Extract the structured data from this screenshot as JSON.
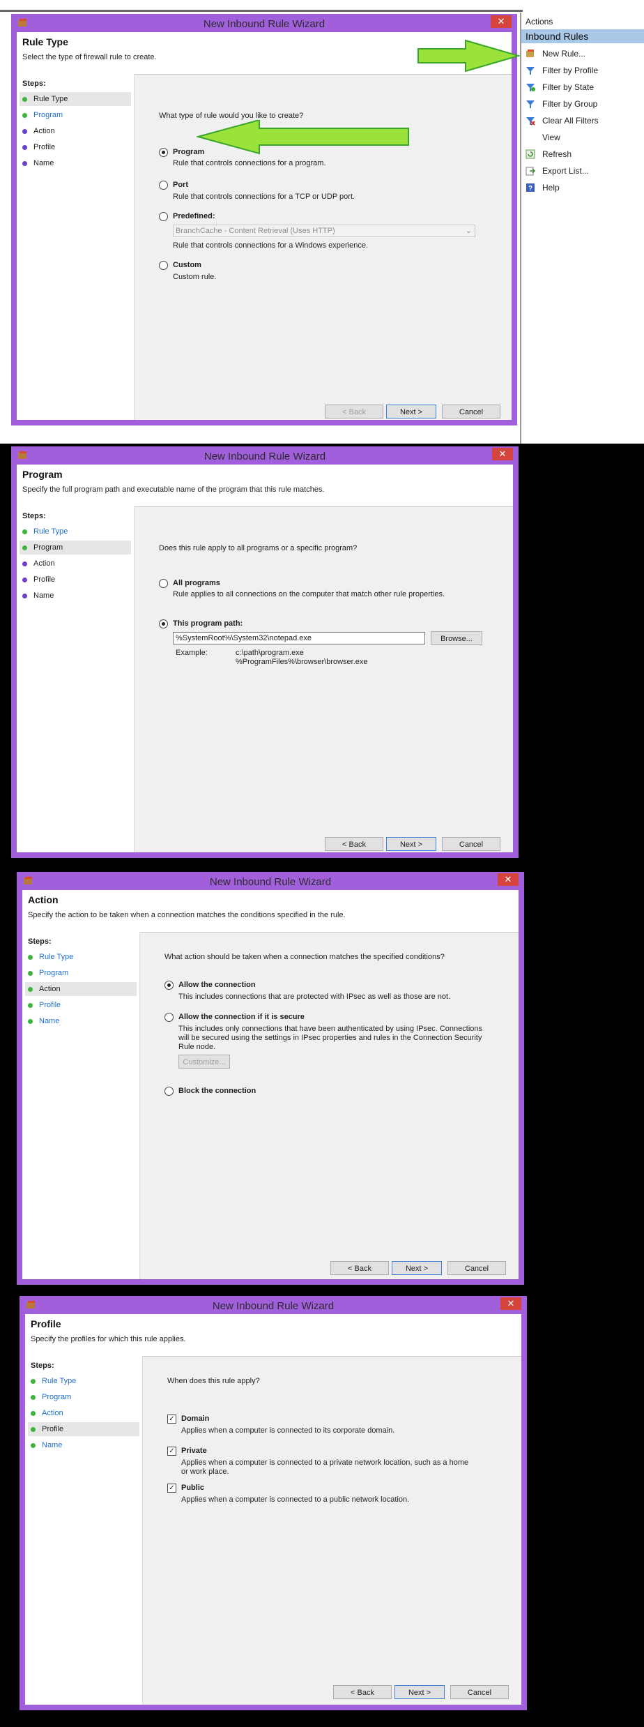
{
  "actions": {
    "header": "Actions",
    "section": "Inbound Rules",
    "items": [
      {
        "label": "New Rule...",
        "icon": "new-rule-icon"
      },
      {
        "label": "Filter by Profile",
        "icon": "filter-icon"
      },
      {
        "label": "Filter by State",
        "icon": "filter-icon"
      },
      {
        "label": "Filter by Group",
        "icon": "filter-icon"
      },
      {
        "label": "Clear All Filters",
        "icon": "clear-filter-icon"
      },
      {
        "label": "View",
        "icon": ""
      },
      {
        "label": "Refresh",
        "icon": "refresh-icon"
      },
      {
        "label": "Export List...",
        "icon": "export-icon"
      },
      {
        "label": "Help",
        "icon": "help-icon"
      }
    ]
  },
  "wizard": {
    "title": "New Inbound Rule Wizard",
    "close": "✕",
    "steps_label": "Steps:",
    "steps": [
      "Rule Type",
      "Program",
      "Action",
      "Profile",
      "Name"
    ],
    "buttons": {
      "back": "< Back",
      "next": "Next >",
      "cancel": "Cancel"
    }
  },
  "panel1": {
    "heading": "Rule Type",
    "subheading": "Select the type of firewall rule to create.",
    "question": "What type of rule would you like to create?",
    "options": [
      {
        "label": "Program",
        "desc": "Rule that controls connections for a program.",
        "selected": true
      },
      {
        "label": "Port",
        "desc": "Rule that controls connections for a TCP or UDP port.",
        "selected": false
      },
      {
        "label": "Predefined:",
        "desc": "Rule that controls connections for a Windows experience.",
        "selected": false
      },
      {
        "label": "Custom",
        "desc": "Custom rule.",
        "selected": false
      }
    ],
    "predefined_value": "BranchCache - Content Retrieval (Uses HTTP)"
  },
  "panel2": {
    "heading": "Program",
    "subheading": "Specify the full program path and executable name of the program that this rule matches.",
    "question": "Does this rule apply to all programs or a specific program?",
    "all_programs": "All programs",
    "all_programs_desc": "Rule applies to all connections on the computer that match other rule properties.",
    "this_path": "This program path:",
    "path_value": "%SystemRoot%\\System32\\notepad.exe",
    "browse": "Browse...",
    "example_label": "Example:",
    "example_1": "c:\\path\\program.exe",
    "example_2": "%ProgramFiles%\\browser\\browser.exe"
  },
  "panel3": {
    "heading": "Action",
    "subheading": "Specify the action to be taken when a connection matches the conditions specified in the rule.",
    "question": "What action should be taken when a connection matches the specified conditions?",
    "allow": "Allow the connection",
    "allow_desc": "This includes connections that are protected with IPsec as well as those are not.",
    "allow_secure": "Allow the connection if it is secure",
    "allow_secure_desc_1": "This includes only connections that have been authenticated by using IPsec.  Connections",
    "allow_secure_desc_2": "will be secured using the settings in IPsec properties and rules in the Connection Security",
    "allow_secure_desc_3": "Rule node.",
    "customize": "Customize...",
    "block": "Block the connection"
  },
  "panel4": {
    "heading": "Profile",
    "subheading": "Specify the profiles for which this rule applies.",
    "question": "When does this rule apply?",
    "domain": "Domain",
    "domain_desc": "Applies when a computer is connected to its corporate domain.",
    "private": "Private",
    "private_desc_1": "Applies when a computer is connected to a private network location, such as a home",
    "private_desc_2": "or work place.",
    "public": "Public",
    "public_desc": "Applies when a computer is connected to a public network location."
  }
}
